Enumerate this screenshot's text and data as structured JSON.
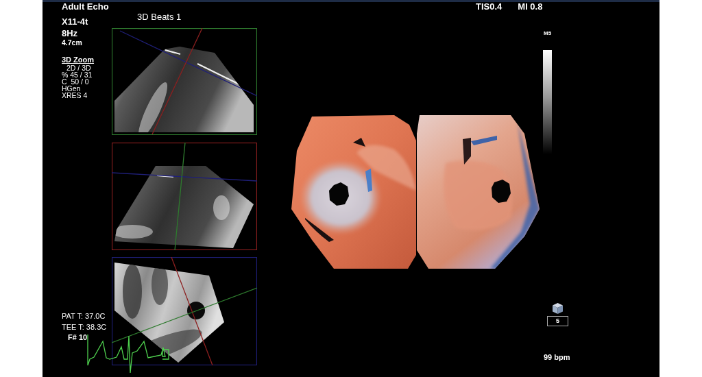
{
  "header": {
    "preset": "Adult Echo",
    "probe": "X11-4t",
    "frame_rate": "8Hz",
    "depth": "4.7cm"
  },
  "view_title": "3D Beats 1",
  "acoustic_output": [
    "TIS0.4",
    "MI 0.8"
  ],
  "mode": {
    "title": "3D Zoom",
    "settings": [
      "2D / 3D",
      "% 45 / 31",
      "C  50 / 0",
      "HGen",
      "XRES 4"
    ]
  },
  "gray_map": {
    "label": "M5"
  },
  "views": [
    {
      "color": "#2e7a2e"
    },
    {
      "color": "#8c1f1f"
    },
    {
      "color": "#1f1f78"
    }
  ],
  "volume": {
    "count": "5"
  },
  "temperatures": [
    "PAT T: 37.0C",
    "TEE T: 38.3C"
  ],
  "frame_number": "F# 10",
  "heart_rate": "99 bpm"
}
